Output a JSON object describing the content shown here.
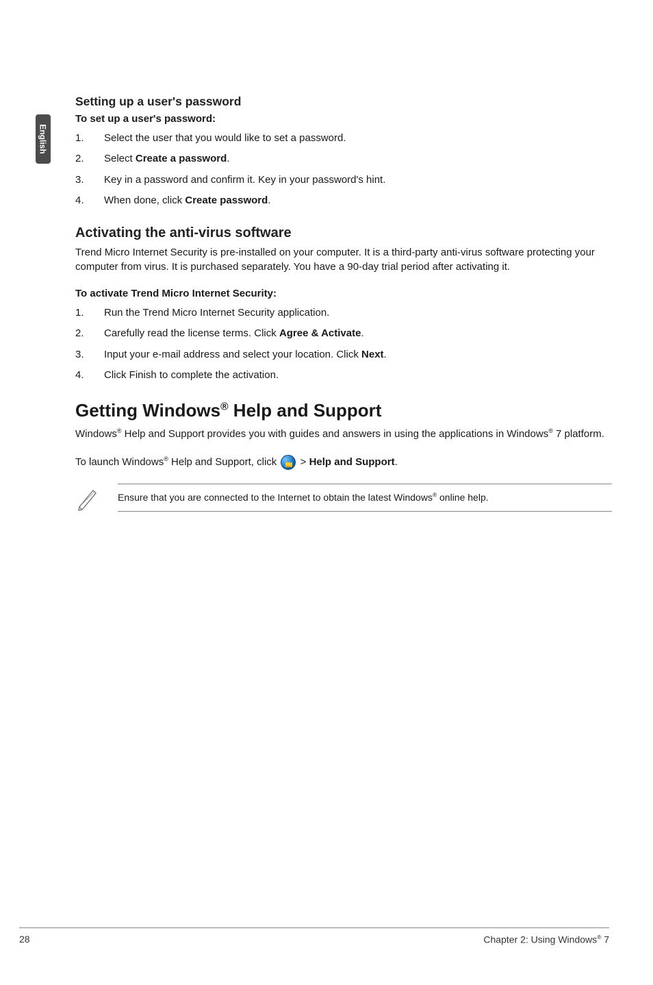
{
  "side_tab": {
    "label": "English"
  },
  "section1": {
    "heading": "Setting up a user's password",
    "lead": "To set up a user's password:",
    "items": [
      {
        "num": "1.",
        "pre": "Select the user that you would like to set a password."
      },
      {
        "num": "2.",
        "pre": "Select ",
        "strong": "Create a password",
        "post": "."
      },
      {
        "num": "3.",
        "pre": "Key in a password and confirm it. Key in your password's hint."
      },
      {
        "num": "4.",
        "pre": "When done, click ",
        "strong": "Create password",
        "post": "."
      }
    ]
  },
  "section2": {
    "heading": "Activating the anti-virus software",
    "para": "Trend Micro Internet Security is pre-installed on your computer. It is a third-party anti-virus software protecting your computer from virus. It is purchased separately. You have a 90-day trial period after activating it.",
    "lead": "To activate Trend Micro Internet Security:",
    "items": [
      {
        "num": "1.",
        "pre": "Run the Trend Micro Internet Security application."
      },
      {
        "num": "2.",
        "pre": "Carefully read the license terms. Click ",
        "strong": "Agree & Activate",
        "post": "."
      },
      {
        "num": "3.",
        "pre": "Input your e-mail address and select your location. Click ",
        "strong": "Next",
        "post": "."
      },
      {
        "num": "4.",
        "pre": "Click Finish to complete the activation."
      }
    ]
  },
  "section3": {
    "title_before": "Getting Windows",
    "title_sup": "®",
    "title_after": " Help and Support",
    "para_parts": {
      "a": "Windows",
      "sup1": "®",
      "b": " Help and Support provides you with guides and answers in using the applications in Windows",
      "sup2": "®",
      "c": " 7 platform."
    },
    "launch_parts": {
      "a": "To launch Windows",
      "sup": "®",
      "b": " Help and Support, click ",
      "icon_name": "windows-start-icon",
      "c": " > ",
      "strong": "Help and Support",
      "d": "."
    },
    "note_parts": {
      "a": "Ensure that you are connected to the Internet to obtain the latest Windows",
      "sup": "®",
      "b": " online help."
    }
  },
  "footer": {
    "page_num": "28",
    "chapter_before": "Chapter 2: Using Windows",
    "chapter_sup": "®",
    "chapter_after": " 7"
  }
}
